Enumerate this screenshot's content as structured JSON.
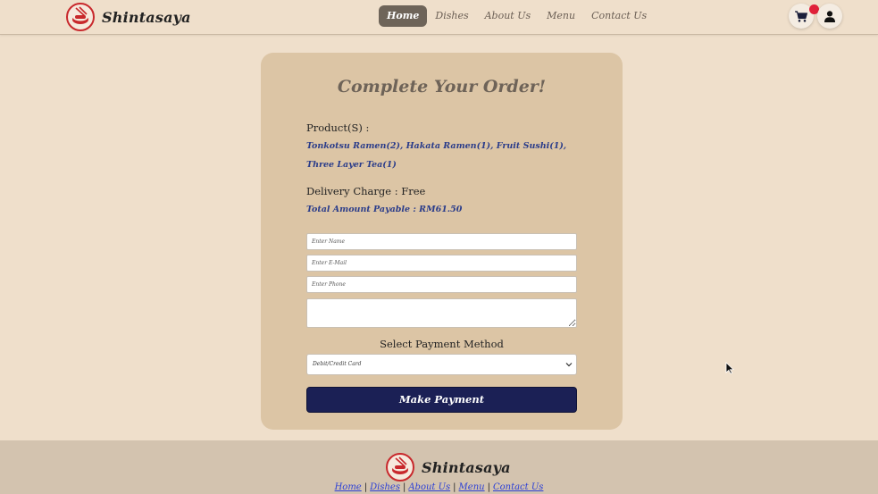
{
  "navbar": {
    "brand": "Shintasaya",
    "links": [
      "Home",
      "Dishes",
      "About Us",
      "Menu",
      "Contact Us"
    ],
    "active_link": "Home",
    "cart_icon": "cart-icon",
    "user_icon": "user-icon",
    "badge_color": "#e0213a"
  },
  "order": {
    "title": "Complete Your Order!",
    "products_label": "Product(S) :",
    "products_value": "Tonkotsu Ramen(2), Hakata Ramen(1), Fruit Sushi(1), Three Layer Tea(1)",
    "delivery_label": "Delivery Charge : Free",
    "total_label": "Total Amount Payable : RM61.50",
    "name_placeholder": "Enter Name",
    "email_placeholder": "Enter E-Mail",
    "phone_placeholder": "Enter Phone",
    "message_placeholder": "",
    "payment_heading": "Select Payment Method",
    "payment_selected": "Debit/Credit Card",
    "pay_button": "Make Payment"
  },
  "footer": {
    "brand": "Shintasaya",
    "links": [
      "Home",
      "Dishes",
      "About Us",
      "Menu",
      "Contact Us"
    ]
  },
  "colors": {
    "page_bg": "#efdfcb",
    "card_bg": "#dcc5a5",
    "accent_text": "#2a3c8a",
    "button_bg": "#1b2055",
    "footer_bg": "#d3c3af",
    "footer_link": "#2b3fd6",
    "logo_red": "#c8282c"
  }
}
